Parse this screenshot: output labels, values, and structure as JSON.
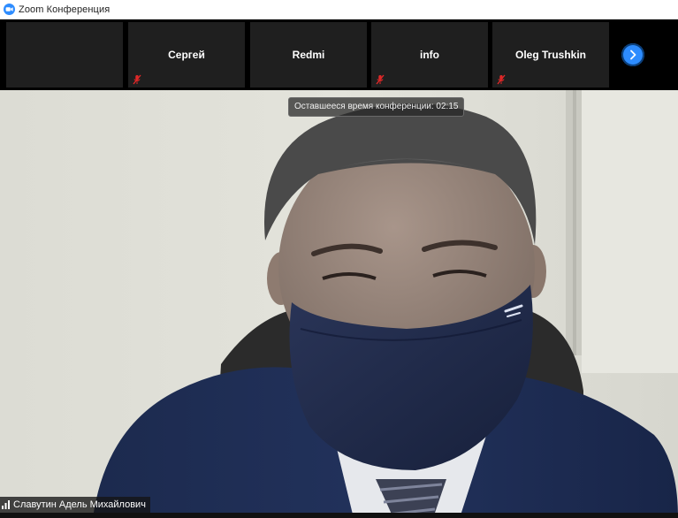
{
  "window": {
    "title": "Zoom Конференция",
    "app_icon": "zoom-camera-icon"
  },
  "participants_strip": {
    "tiles": [
      {
        "name": "",
        "muted": false
      },
      {
        "name": "Сергей",
        "muted": true
      },
      {
        "name": "Redmi",
        "muted": false
      },
      {
        "name": "info",
        "muted": true
      },
      {
        "name": "Oleg Trushkin",
        "muted": true
      }
    ],
    "next_icon": "chevron-right-icon"
  },
  "meeting": {
    "time_remaining_label": "Оставшееся время конференции: 02:15"
  },
  "active_speaker": {
    "name": "Славутин Адель Михайлович",
    "signal_icon": "connection-bars-icon",
    "wearing": "dark navy face mask"
  },
  "colors": {
    "accent_blue": "#2d8cff",
    "mute_red": "#e02828",
    "strip_bg": "#000000",
    "tile_bg": "#1f1f1f"
  }
}
